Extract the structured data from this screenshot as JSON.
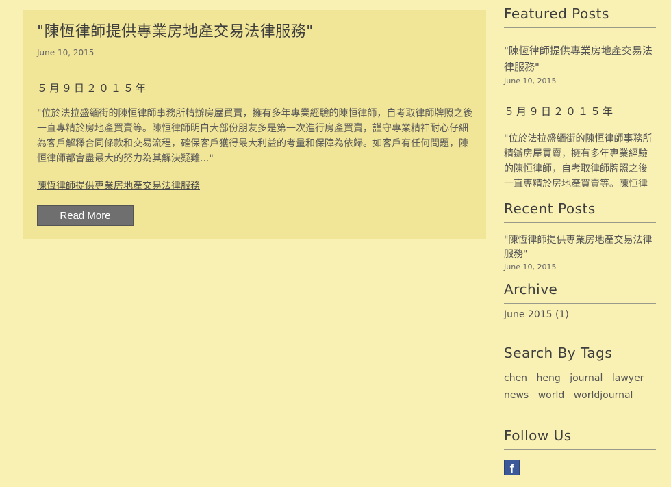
{
  "post": {
    "title": "\"陳恆律師提供專業房地產交易法律服務\"",
    "date": "June 10, 2015",
    "subtitle": "５月９日２０１５年",
    "excerpt": "\"位於法拉盛緬街的陳恒律師事務所精辦房屋買賣，擁有多年專業經驗的陳恒律師，自考取律師牌照之後一直專精於房地產買賣等。陳恒律師明白大部份朋友多是第一次進行房產買賣，謹守專業精神耐心仔細為客戶解釋合同條款和交易流程，確保客戶獲得最大利益的考量和保障為依歸。如客戶有任何問題，陳恒律師都會盡最大的努力為其解決疑難...\"",
    "link_text": "陳恆律師提供專業房地產交易法律服務",
    "read_more": "Read More"
  },
  "sidebar": {
    "featured": {
      "heading": "Featured Posts",
      "title": "\"陳恆律師提供專業房地產交易法律服務\"",
      "date": "June 10, 2015",
      "subtitle": "５月９日２０１５年",
      "excerpt": "\"位於法拉盛緬街的陳恒律師事務所精辦房屋買賣，擁有多年專業經驗的陳恒律師，自考取律師牌照之後一直專精於房地產買賣等。陳恒律師明白大部份朋友多是第一次進行房產買賣"
    },
    "recent": {
      "heading": "Recent Posts",
      "title": "\"陳恆律師提供專業房地產交易法律服務\"",
      "date": "June 10, 2015"
    },
    "archive": {
      "heading": "Archive",
      "item": "June 2015 (1)"
    },
    "tags": {
      "heading": "Search By Tags",
      "items": [
        "chen",
        "heng",
        "journal",
        "lawyer",
        "news",
        "world",
        "worldjournal"
      ]
    },
    "follow": {
      "heading": "Follow Us",
      "icon": "facebook-icon",
      "icon_glyph": "f"
    }
  },
  "colors": {
    "background": "#f9f0b4",
    "card": "#f1e597",
    "button": "#6f6f6f",
    "facebook": "#3b5998"
  }
}
